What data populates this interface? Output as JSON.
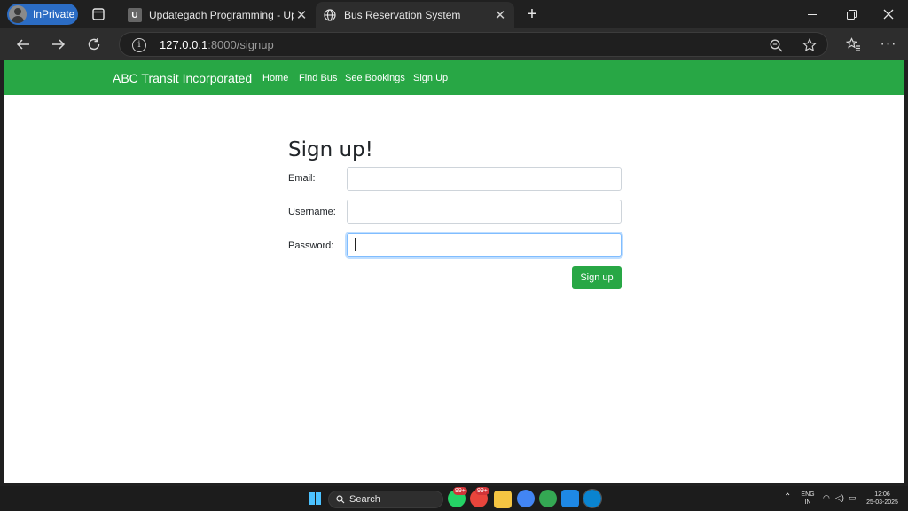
{
  "browser": {
    "inprivate_label": "InPrivate",
    "tabs": [
      {
        "title": "Updategadh Programming - Upd",
        "favicon": "updategadh-logo-icon",
        "active": false
      },
      {
        "title": "Bus Reservation System",
        "favicon": "globe-icon",
        "active": true
      }
    ],
    "new_tab_label": "+",
    "close_label": "✕",
    "address": {
      "host": "127.0.0.1",
      "path": ":8000/signup"
    }
  },
  "site": {
    "brand": "ABC Transit Incorporated",
    "nav": [
      {
        "label": "Home"
      },
      {
        "label": "Find Bus"
      },
      {
        "label": "See Bookings"
      },
      {
        "label": "Sign Up"
      }
    ],
    "accent_color": "#28a745"
  },
  "form": {
    "heading": "Sign up!",
    "fields": [
      {
        "label": "Email:",
        "value": "",
        "placeholder": ""
      },
      {
        "label": "Username:",
        "value": "",
        "placeholder": ""
      },
      {
        "label": "Password:",
        "value": "",
        "placeholder": "",
        "focused": true
      }
    ],
    "submit_label": "Sign up"
  },
  "taskbar": {
    "search_label": "Search",
    "whatsapp_badge": "99+",
    "chrome_badge": "99+",
    "lang_top": "ENG",
    "lang_bottom": "IN",
    "time": "12:06",
    "date": "25-03-2025"
  }
}
